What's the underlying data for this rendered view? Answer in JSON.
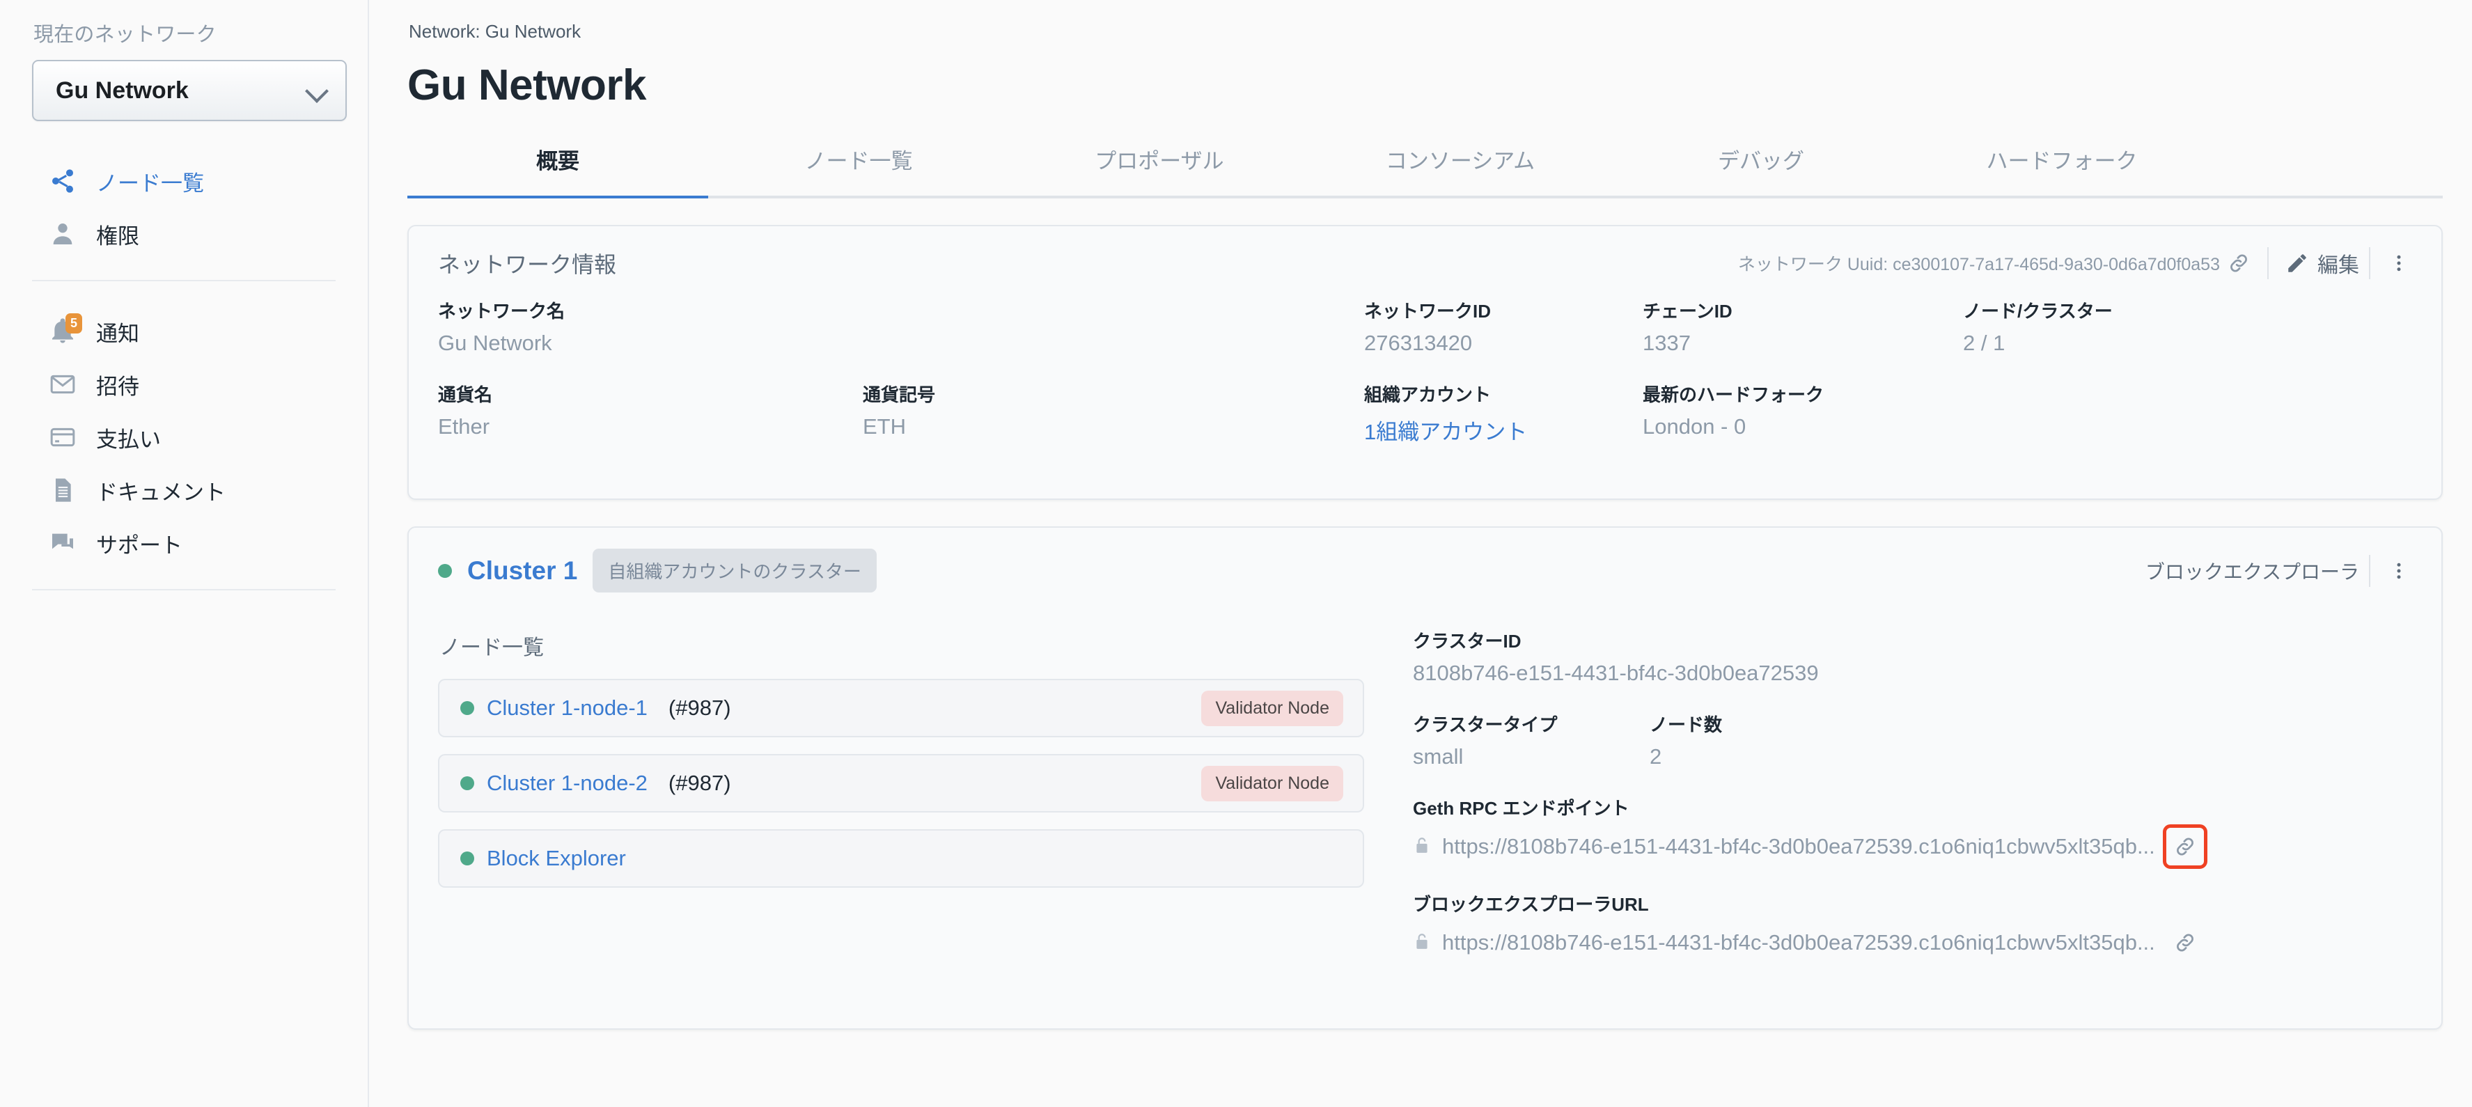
{
  "sidebar": {
    "caption": "現在のネットワーク",
    "network_select": {
      "value": "Gu Network",
      "chevron_icon": "chevron-down-icon"
    },
    "items": [
      {
        "label": "ノード一覧",
        "icon": "share-nodes-icon",
        "is_link": true
      },
      {
        "label": "権限",
        "icon": "person-icon",
        "is_link": false
      }
    ],
    "items2": [
      {
        "label": "通知",
        "icon": "bell-icon",
        "badge": "5"
      },
      {
        "label": "招待",
        "icon": "envelope-icon",
        "badge": ""
      },
      {
        "label": "支払い",
        "icon": "credit-card-icon",
        "badge": ""
      },
      {
        "label": "ドキュメント",
        "icon": "document-icon",
        "badge": ""
      },
      {
        "label": "サポート",
        "icon": "chat-bubbles-icon",
        "badge": ""
      }
    ]
  },
  "header": {
    "breadcrumb": "Network: Gu Network",
    "title": "Gu Network"
  },
  "tabs": [
    {
      "label": "概要",
      "active": true
    },
    {
      "label": "ノード一覧",
      "active": false
    },
    {
      "label": "プロポーザル",
      "active": false
    },
    {
      "label": "コンソーシアム",
      "active": false
    },
    {
      "label": "デバッグ",
      "active": false
    },
    {
      "label": "ハードフォーク",
      "active": false
    }
  ],
  "network_info": {
    "card_title": "ネットワーク情報",
    "uuid_label": "ネットワーク Uuid: ce300107-7a17-465d-9a30-0d6a7d0f0a53",
    "copy_icon": "link-icon",
    "edit_label": "編集",
    "edit_icon": "pencil-icon",
    "more_icon": "kebab-menu-icon",
    "fields": {
      "network_name_label": "ネットワーク名",
      "network_name_value": "Gu Network",
      "currency_name_label": "通貨名",
      "currency_name_value": "Ether",
      "currency_symbol_label": "通貨記号",
      "currency_symbol_value": "ETH",
      "network_id_label": "ネットワークID",
      "network_id_value": "276313420",
      "chain_id_label": "チェーンID",
      "chain_id_value": "1337",
      "nodes_clusters_label": "ノード/クラスター",
      "nodes_clusters_value": "2 / 1",
      "org_account_label": "組織アカウント",
      "org_account_value": "1組織アカウント",
      "latest_hardfork_label": "最新のハードフォーク",
      "latest_hardfork_value": "London - 0"
    }
  },
  "cluster": {
    "status_dot_color": "#4fa98a",
    "name": "Cluster 1",
    "chip_label": "自組織アカウントのクラスター",
    "explorer_link": "ブロックエクスプローラ",
    "more_icon": "kebab-menu-icon",
    "nodes_title": "ノード一覧",
    "nodes": [
      {
        "name": "Cluster 1-node-1",
        "number": "(#987)",
        "tag": "Validator Node"
      },
      {
        "name": "Cluster 1-node-2",
        "number": "(#987)",
        "tag": "Validator Node"
      },
      {
        "name": "Block Explorer",
        "number": "",
        "tag": ""
      }
    ],
    "details": {
      "cluster_id_label": "クラスターID",
      "cluster_id_value": "8108b746-e151-4431-bf4c-3d0b0ea72539",
      "cluster_type_label": "クラスタータイプ",
      "cluster_type_value": "small",
      "node_count_label": "ノード数",
      "node_count_value": "2",
      "rpc_label": "Geth RPC エンドポイント",
      "rpc_value": "https://8108b746-e151-4431-bf4c-3d0b0ea72539.c1o6niq1cbwv5xlt35qb...",
      "explorer_url_label": "ブロックエクスプローラURL",
      "explorer_url_value": "https://8108b746-e151-4431-bf4c-3d0b0ea72539.c1o6niq1cbwv5xlt35qb...",
      "copy_icon": "link-icon",
      "lock_icon": "lock-icon"
    }
  },
  "colors": {
    "accent_blue": "#3a7bd0",
    "status_green": "#4fa98a",
    "badge_orange": "#e8943a",
    "tag_pink": "#f6dcdc",
    "highlight_red": "#ef4123"
  }
}
